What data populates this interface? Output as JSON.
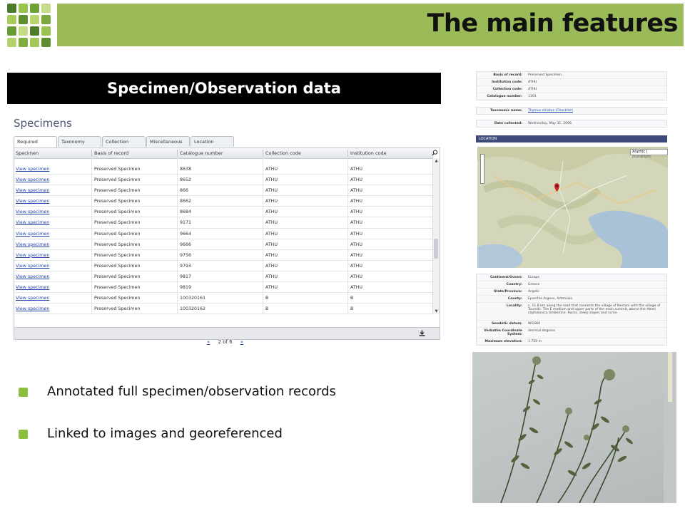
{
  "header": {
    "title": "The main features"
  },
  "section": {
    "banner": "Specimen/Observation data"
  },
  "specimens": {
    "title": "Specimens",
    "tabs": [
      "Required",
      "Taxonomy",
      "Collection",
      "Miscellaneous",
      "Location"
    ],
    "columns": [
      "Specimen",
      "Basis of record",
      "Catalogue number",
      "Collection code",
      "Institution code"
    ],
    "rows": [
      [
        "View specimen",
        "Preserved Specimen",
        "8638",
        "ATHU",
        "ATHU"
      ],
      [
        "View specimen",
        "Preserved Specimen",
        "8652",
        "ATHU",
        "ATHU"
      ],
      [
        "View specimen",
        "Preserved Specimen",
        "866",
        "ATHU",
        "ATHU"
      ],
      [
        "View specimen",
        "Preserved Specimen",
        "8662",
        "ATHU",
        "ATHU"
      ],
      [
        "View specimen",
        "Preserved Specimen",
        "8684",
        "ATHU",
        "ATHU"
      ],
      [
        "View specimen",
        "Preserved Specimen",
        "9171",
        "ATHU",
        "ATHU"
      ],
      [
        "View specimen",
        "Preserved Specimen",
        "9664",
        "ATHU",
        "ATHU"
      ],
      [
        "View specimen",
        "Preserved Specimen",
        "9666",
        "ATHU",
        "ATHU"
      ],
      [
        "View specimen",
        "Preserved Specimen",
        "9756",
        "ATHU",
        "ATHU"
      ],
      [
        "View specimen",
        "Preserved Specimen",
        "9793",
        "ATHU",
        "ATHU"
      ],
      [
        "View specimen",
        "Preserved Specimen",
        "9817",
        "ATHU",
        "ATHU"
      ],
      [
        "View specimen",
        "Preserved Specimen",
        "9819",
        "ATHU",
        "ATHU"
      ],
      [
        "View specimen",
        "Preserved Specimen",
        "100320161",
        "B",
        "B"
      ],
      [
        "View specimen",
        "Preserved Specimen",
        "100320162",
        "B",
        "B"
      ]
    ],
    "pager": {
      "prev": "«",
      "label": "2 of 6",
      "next": "»"
    }
  },
  "bullets": [
    "Annotated full specimen/observation records",
    "Linked to images and georeferenced"
  ],
  "record": {
    "basis_of_record": {
      "label": "Basis of record:",
      "value": "Preserved Specimen"
    },
    "institution_code": {
      "label": "Institution code:",
      "value": "ATHU"
    },
    "collection_code": {
      "label": "Collection code:",
      "value": "ATHU"
    },
    "catalogue_number": {
      "label": "Catalogue number:",
      "value": "1191"
    },
    "taxonomic_name": {
      "label": "Taxonomic name:",
      "value": "Thymus striatus (Checklist)"
    },
    "date_collected": {
      "label": "Date collected:",
      "value": "Wednesday, May 31, 2006"
    },
    "location_title": "LOCATION",
    "map_controls": {
      "map": "Χάρτης",
      "satellite": "Δορυφόρος"
    },
    "continent": {
      "label": "Continent/Ocean:",
      "value": "Europe"
    },
    "country": {
      "label": "Country:",
      "value": "Greece"
    },
    "state": {
      "label": "State/Province:",
      "value": "Argolis"
    },
    "county": {
      "label": "County:",
      "value": "Eparchia Argous, Artemisio"
    },
    "locality": {
      "label": "Locality:",
      "value": "c. 11.8 km along the road that connects the village of Nestani with the village of Tourniki. The E medium and upper parts of the main summit, above the Abies cephalonica timberline. Rocks, steep slopes and scree"
    },
    "geodetic": {
      "label": "Geodetic datum:",
      "value": "WGS84"
    },
    "verbatim": {
      "label": "Verbatim Coordinate System:",
      "value": "decimal degrees"
    },
    "max_elev": {
      "label": "Maximum elevation:",
      "value": "1 750 m"
    }
  },
  "colors": {
    "header_green": "#9bbb59",
    "bullet_green": "#8cbf3f",
    "link_blue": "#2244aa",
    "location_bar": "#3d4a7a"
  }
}
